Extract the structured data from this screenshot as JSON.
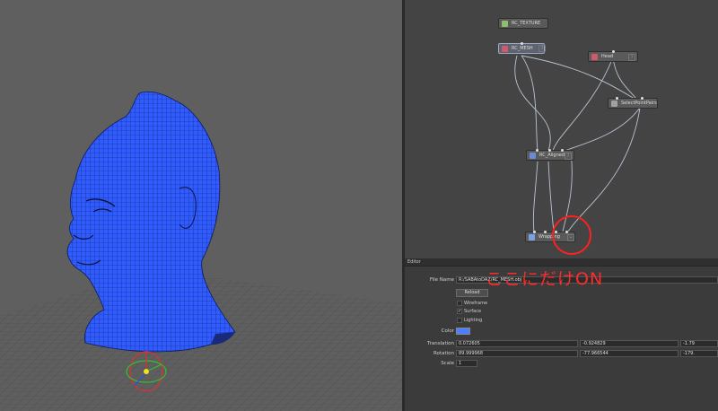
{
  "nodes": {
    "texture": {
      "label": "RC_TEXTURE",
      "icon_color": "#8cc06a"
    },
    "mesh": {
      "label": "RC_MESH",
      "icon_color": "#d05a6a"
    },
    "head": {
      "label": "Head",
      "icon_color": "#d05a6a"
    },
    "select_point_pairs": {
      "label": "SelectPointPairs",
      "icon_color": "#a0a0a0"
    },
    "aligned": {
      "label": "RC_Aligned",
      "icon_color": "#6a8ad8"
    },
    "wrapping": {
      "label": "Wrapping",
      "icon_color": "#7aa0e8"
    }
  },
  "editor": {
    "header": "Editor",
    "file_name_label": "File Name",
    "file_name_value": "R:/SABAtoDAZ/RC_MESH.obj",
    "reload_label": "Reload",
    "wireframe_label": "Wireframe",
    "wireframe_checked": "",
    "surface_label": "Surface",
    "surface_checked": "✓",
    "lighting_label": "Lighting",
    "lighting_checked": "",
    "color_label": "Color",
    "color_value": "#4a7fff",
    "translation_label": "Translation",
    "translation": [
      "0.072605",
      "-0.924829",
      "-1.79"
    ],
    "rotation_label": "Rotation",
    "rotation": [
      "89.999968",
      "-77.966544",
      "-179."
    ],
    "scale_label": "Scale",
    "scale_value": "1"
  },
  "annotation": {
    "text": "ここにだけON",
    "color": "#ff2a2a"
  },
  "viewport": {
    "mesh_color": "#2f5bff",
    "wire_color": "#0d1b55"
  }
}
